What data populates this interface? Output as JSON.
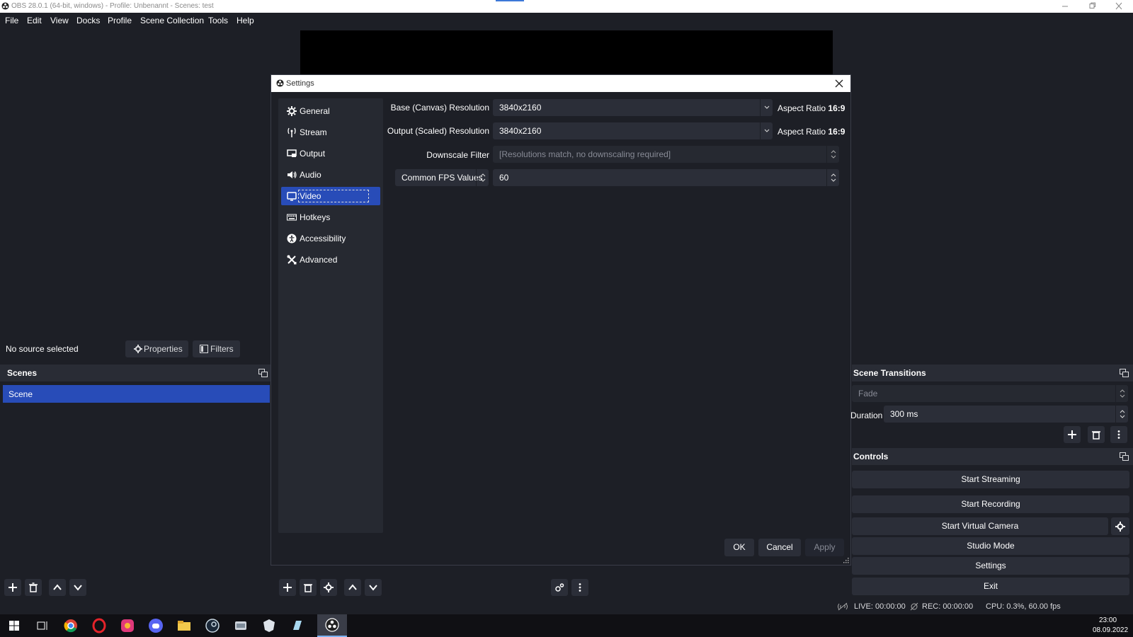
{
  "window": {
    "title": "OBS 28.0.1 (64-bit, windows) - Profile: Unbenannt - Scenes: test"
  },
  "menu": [
    "File",
    "Edit",
    "View",
    "Docks",
    "Profile",
    "Scene Collection",
    "Tools",
    "Help"
  ],
  "source_bar": {
    "no_source": "No source selected",
    "properties": "Properties",
    "filters": "Filters"
  },
  "scenes": {
    "title": "Scenes",
    "items": [
      "Scene"
    ]
  },
  "transitions": {
    "title": "Scene Transitions",
    "type": "Fade",
    "duration_label": "Duration",
    "duration_value": "300 ms"
  },
  "controls": {
    "title": "Controls",
    "start_streaming": "Start Streaming",
    "start_recording": "Start Recording",
    "start_virtual_camera": "Start Virtual Camera",
    "studio_mode": "Studio Mode",
    "settings": "Settings",
    "exit": "Exit"
  },
  "status": {
    "live": "LIVE: 00:00:00",
    "rec": "REC: 00:00:00",
    "cpu": "CPU: 0.3%, 60.00 fps"
  },
  "taskbar": {
    "time": "23:00",
    "date": "08.09.2022"
  },
  "settings_dialog": {
    "title": "Settings",
    "nav": [
      "General",
      "Stream",
      "Output",
      "Audio",
      "Video",
      "Hotkeys",
      "Accessibility",
      "Advanced"
    ],
    "selected": "Video",
    "base_label": "Base (Canvas) Resolution",
    "base_value": "3840x2160",
    "output_label": "Output (Scaled) Resolution",
    "output_value": "3840x2160",
    "aspect_prefix": "Aspect Ratio",
    "aspect_value": "16:9",
    "downscale_label": "Downscale Filter",
    "downscale_value": "[Resolutions match, no downscaling required]",
    "fps_type": "Common FPS Values",
    "fps_value": "60",
    "ok": "OK",
    "cancel": "Cancel",
    "apply": "Apply"
  },
  "colors": {
    "accent": "#284cb8",
    "background": "#1d1f26",
    "button": "#2b2e38"
  }
}
